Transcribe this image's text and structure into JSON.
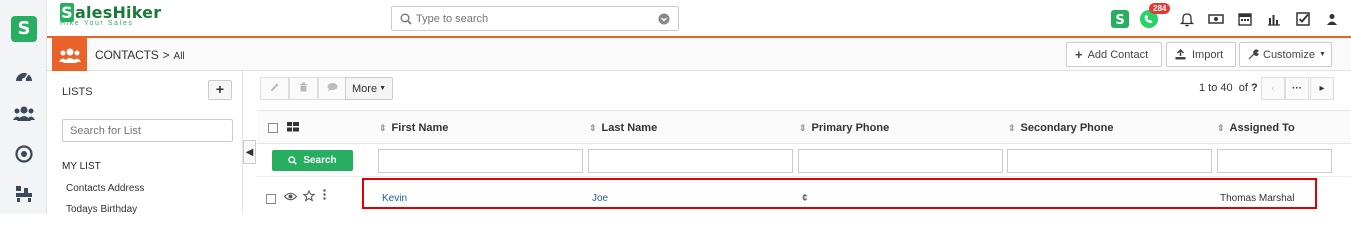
{
  "rail": {
    "logo_letter": "S",
    "icons": [
      "dashboard-icon",
      "users-icon",
      "target-icon",
      "hierarchy-icon"
    ]
  },
  "brand": {
    "name_initial": "S",
    "name_rest": "alesHiker",
    "tagline": "Hike Your Sales"
  },
  "topbar": {
    "search_placeholder": "Type to search",
    "whatsapp_badge": "284",
    "icons": [
      "saleshiker-icon",
      "whatsapp-icon",
      "bell-icon",
      "money-icon",
      "calendar-icon",
      "bar-chart-icon",
      "checkbox-icon",
      "user-icon"
    ]
  },
  "module": {
    "title": "CONTACTS",
    "separator": ">",
    "subtitle": "All",
    "add_contact": "Add Contact",
    "import": "Import",
    "customize": "Customize"
  },
  "lists": {
    "title": "LISTS",
    "add_label": "+",
    "search_placeholder": "Search for List",
    "my_list": "MY LIST",
    "items": [
      "Contacts Address",
      "Todays Birthday"
    ]
  },
  "toolbar": {
    "more_label": "More",
    "pager_range": "1 to 40",
    "pager_of": "of",
    "pager_total": "?",
    "pager_dots": "···"
  },
  "table": {
    "columns": [
      "First Name",
      "Last Name",
      "Primary Phone",
      "Secondary Phone",
      "Assigned To"
    ],
    "search_button": "Search",
    "rows": [
      {
        "first_name": "Kevin",
        "last_name": "Joe",
        "primary_phone": "¢",
        "secondary_phone": "",
        "assigned_to": "Thomas Marshal"
      }
    ]
  },
  "colors": {
    "accent_orange": "#e8622a",
    "brand_green": "#27ae60",
    "link_blue": "#1f5d99",
    "highlight_red": "#e00000"
  }
}
